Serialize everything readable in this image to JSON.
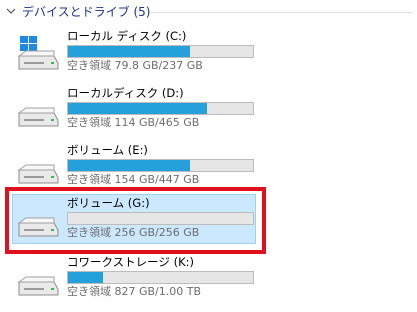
{
  "section": {
    "title": "デバイスとドライブ (5)"
  },
  "drives": [
    {
      "name": "ローカル ディスク (C:)",
      "free_text": "空き領域 79.8 GB/237 GB",
      "used_fraction": 0.66,
      "icon": "windows-drive-icon",
      "selected": false
    },
    {
      "name": "ローカルディスク (D:)",
      "free_text": "空き領域 114 GB/465 GB",
      "used_fraction": 0.75,
      "icon": "hard-drive-icon",
      "selected": false
    },
    {
      "name": "ボリューム (E:)",
      "free_text": "空き領域 154 GB/447 GB",
      "used_fraction": 0.66,
      "icon": "hard-drive-icon",
      "selected": false
    },
    {
      "name": "ボリューム (G:)",
      "free_text": "空き領域 256 GB/256 GB",
      "used_fraction": 0.0,
      "icon": "hard-drive-icon",
      "selected": true
    },
    {
      "name": "コワークストレージ (K:)",
      "free_text": "空き領域 827 GB/1.00 TB",
      "used_fraction": 0.19,
      "icon": "hard-drive-icon",
      "selected": false
    }
  ],
  "colors": {
    "accent_bar": "#26a0da",
    "highlight_frame": "#e0101e",
    "header_text": "#1e3287",
    "selection_bg": "#cce8ff"
  }
}
